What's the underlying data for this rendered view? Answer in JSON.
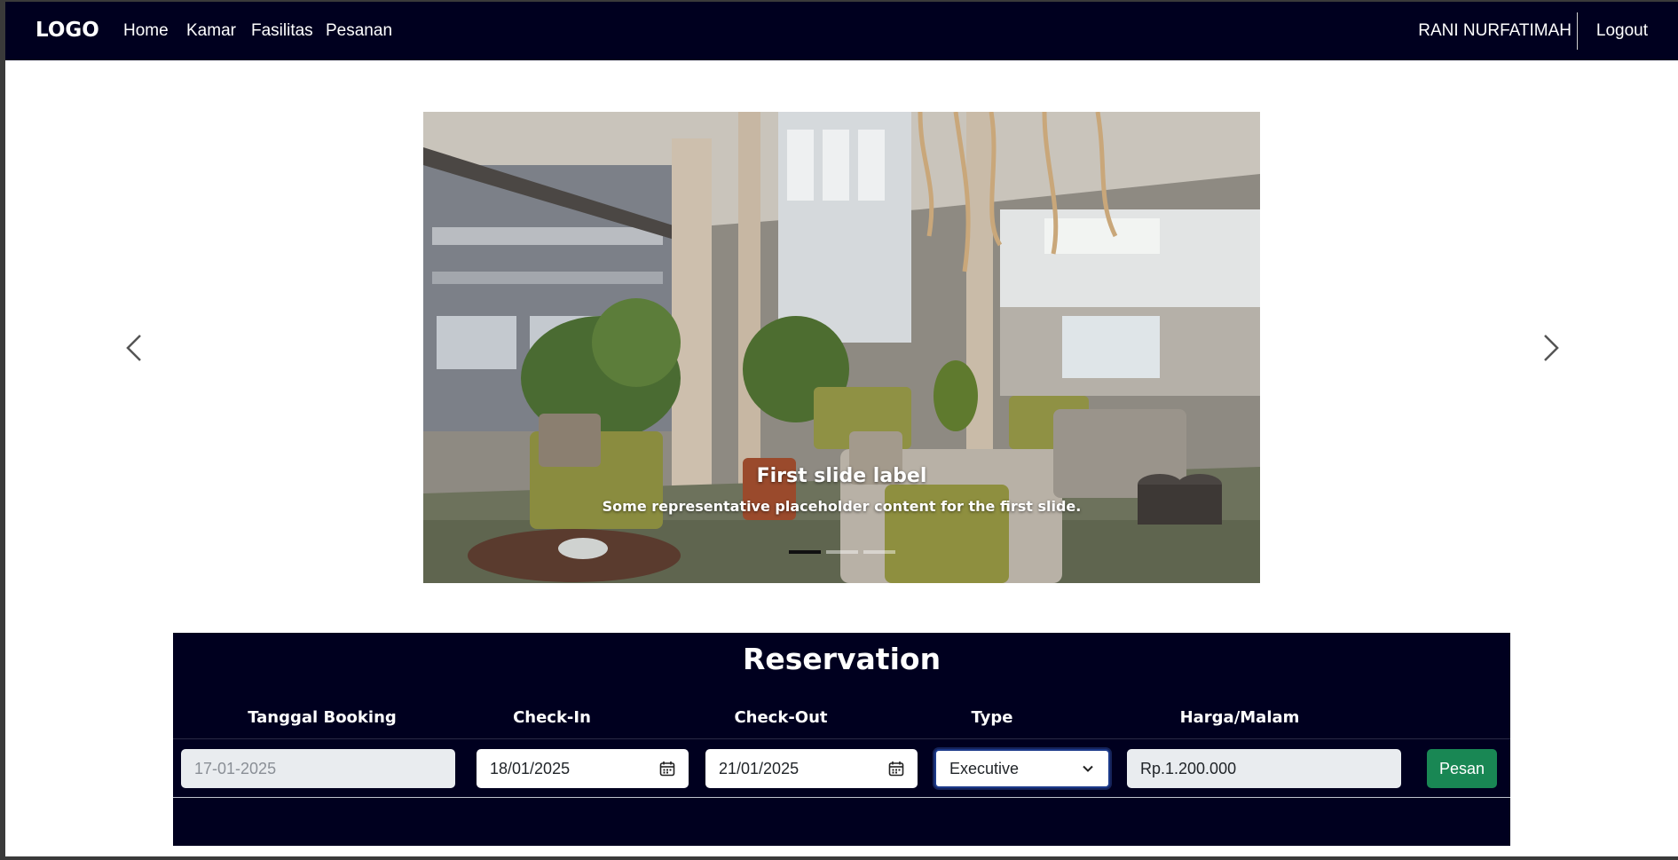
{
  "navbar": {
    "brand": "LOGO",
    "links": [
      "Home",
      "Kamar",
      "Fasilitas",
      "Pesanan"
    ],
    "user_name": "RANI NURFATIMAH",
    "logout": "Logout"
  },
  "carousel": {
    "caption_title": "First slide label",
    "caption_text": "Some representative placeholder content for the first slide.",
    "slide_count": 3,
    "active_slide": 1
  },
  "reservation": {
    "title": "Reservation",
    "headers": {
      "booking_date": "Tanggal Booking",
      "check_in": "Check-In",
      "check_out": "Check-Out",
      "type": "Type",
      "price": "Harga/Malam"
    },
    "booking_date_value": "17-01-2025",
    "check_in_value": "18/01/2025",
    "check_out_value": "21/01/2025",
    "type_value": "Executive",
    "price_value": "Rp.1.200.000",
    "submit_label": "Pesan"
  },
  "colors": {
    "navbar_bg": "#00001f",
    "accent_green": "#198754"
  }
}
